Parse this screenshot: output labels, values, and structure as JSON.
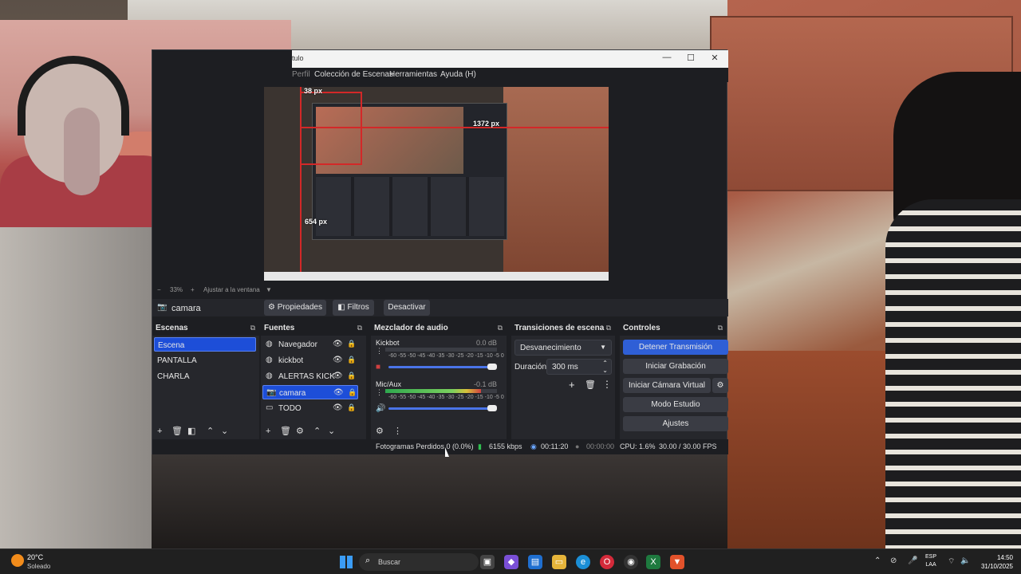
{
  "window": {
    "title_fragment": "tulo",
    "minimize": "—",
    "maximize": "☐",
    "close": "✕"
  },
  "menu": {
    "items": [
      "Perfil",
      "Colección de Escenas",
      "Herramientas",
      "Ayuda (H)"
    ]
  },
  "preview": {
    "labels": {
      "top": "38 px",
      "right": "1372 px",
      "left": "654 px"
    },
    "zoom": "33%",
    "fit_label": "Ajustar a la ventana"
  },
  "source_toolbar": {
    "source_name": "camara",
    "properties": "Propiedades",
    "filters": "Filtros",
    "deactivate": "Desactivar"
  },
  "scenes": {
    "title": "Escenas",
    "items": [
      "Escena",
      "PANTALLA",
      "CHARLA"
    ],
    "selected": 0
  },
  "sources": {
    "title": "Fuentes",
    "items": [
      {
        "name": "Navegador",
        "icon": "browser-icon"
      },
      {
        "name": "kickbot",
        "icon": "browser-icon"
      },
      {
        "name": "ALERTAS KICK",
        "icon": "browser-icon"
      },
      {
        "name": "camara",
        "icon": "camera-icon"
      },
      {
        "name": "TODO",
        "icon": "window-capture-icon"
      }
    ],
    "selected": 3
  },
  "mixer": {
    "title": "Mezclador de audio",
    "channels": [
      {
        "name": "Kickbot",
        "db": "0.0 dB",
        "level": 0.0
      },
      {
        "name": "Mic/Aux",
        "db": "-0.1 dB",
        "level": 0.86
      }
    ],
    "scale": "-60 -55 -50 -45 -40 -35 -30 -25 -20 -15 -10 -5 0"
  },
  "transitions": {
    "title": "Transiciones de escena",
    "selected": "Desvanecimiento",
    "duration_label": "Duración",
    "duration_value": "300 ms"
  },
  "controls": {
    "title": "Controles",
    "stop_stream": "Detener Transmisión",
    "start_recording": "Iniciar Grabación",
    "virtual_cam": "Iniciar Cámara Virtual",
    "studio_mode": "Modo Estudio",
    "settings": "Ajustes"
  },
  "status": {
    "dropped": "Fotogramas Perdidos 0 (0.0%)",
    "bitrate": "6155 kbps",
    "stream_time": "00:11:20",
    "rec_time": "00:00:00",
    "cpu": "CPU: 1.6%",
    "fps": "30.00 / 30.00 FPS"
  },
  "taskbar": {
    "weather_temp": "20°C",
    "weather_desc": "Soleado",
    "search_placeholder": "Buscar",
    "lang_top": "ESP",
    "lang_bottom": "LAA",
    "time": "14:50",
    "date": "31/10/2025"
  },
  "colors": {
    "accent": "#2f5fd6",
    "selection": "#1d4ed8",
    "guide_red": "#d32828"
  }
}
